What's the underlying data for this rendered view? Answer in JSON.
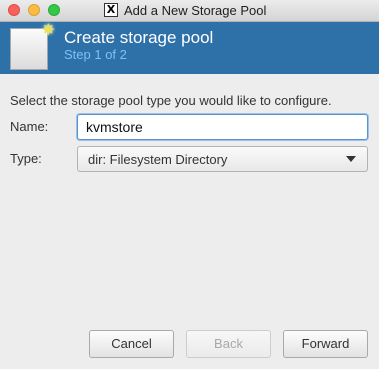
{
  "window": {
    "title": "Add a New Storage Pool",
    "x_logo": "X"
  },
  "header": {
    "title": "Create storage pool",
    "step": "Step 1 of 2",
    "icon": "storage-pool-new-icon"
  },
  "form": {
    "prompt": "Select the storage pool type you would like to configure.",
    "name_label": "Name:",
    "name_value": "kvmstore",
    "type_label": "Type:",
    "type_value": "dir: Filesystem Directory"
  },
  "buttons": {
    "cancel": "Cancel",
    "back": "Back",
    "forward": "Forward"
  },
  "colors": {
    "header_bg": "#2e71a8",
    "step_text": "#7fc0f5"
  }
}
